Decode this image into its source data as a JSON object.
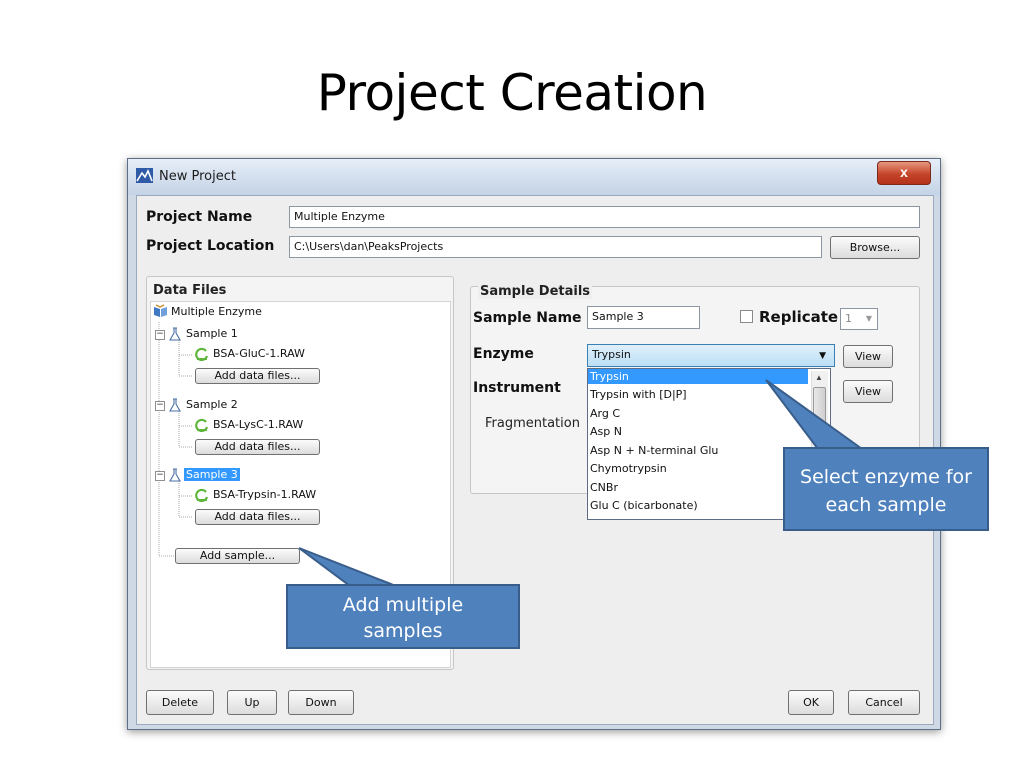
{
  "slide": {
    "title": "Project Creation"
  },
  "window": {
    "title": "New Project",
    "close_glyph": "x",
    "project_name_label": "Project Name",
    "project_name_value": "Multiple Enzyme",
    "project_location_label": "Project Location",
    "project_location_value": "C:\\Users\\dan\\PeaksProjects",
    "browse_label": "Browse...",
    "data_files": {
      "title": "Data Files",
      "root": "Multiple Enzyme",
      "samples": [
        {
          "name": "Sample 1",
          "file": "BSA-GluC-1.RAW",
          "add_label": "Add data files..."
        },
        {
          "name": "Sample 2",
          "file": "BSA-LysC-1.RAW",
          "add_label": "Add data files..."
        },
        {
          "name": "Sample 3",
          "file": "BSA-Trypsin-1.RAW",
          "add_label": "Add data files..."
        }
      ],
      "add_sample_label": "Add sample..."
    },
    "sample_details": {
      "title": "Sample Details",
      "sample_name_label": "Sample Name",
      "sample_name_value": "Sample 3",
      "replicate_label": "Replicate",
      "replicate_value": "1",
      "enzyme_label": "Enzyme",
      "enzyme_value": "Trypsin",
      "view_label": "View",
      "instrument_label": "Instrument",
      "view2_label": "View",
      "fragmentation_label": "Fragmentation"
    },
    "enzyme_options": [
      "Trypsin",
      "Trypsin with [D|P]",
      "Arg C",
      "Asp N",
      "Asp N + N-terminal Glu",
      "Chymotrypsin",
      "CNBr",
      "Glu C (bicarbonate)"
    ],
    "footer": {
      "delete_label": "Delete",
      "up_label": "Up",
      "down_label": "Down",
      "ok_label": "OK",
      "cancel_label": "Cancel"
    }
  },
  "callouts": {
    "enzyme": "Select enzyme for each sample",
    "samples": "Add multiple samples"
  },
  "colors": {
    "callout_fill": "#4f81bd",
    "selection": "#3399ff"
  }
}
